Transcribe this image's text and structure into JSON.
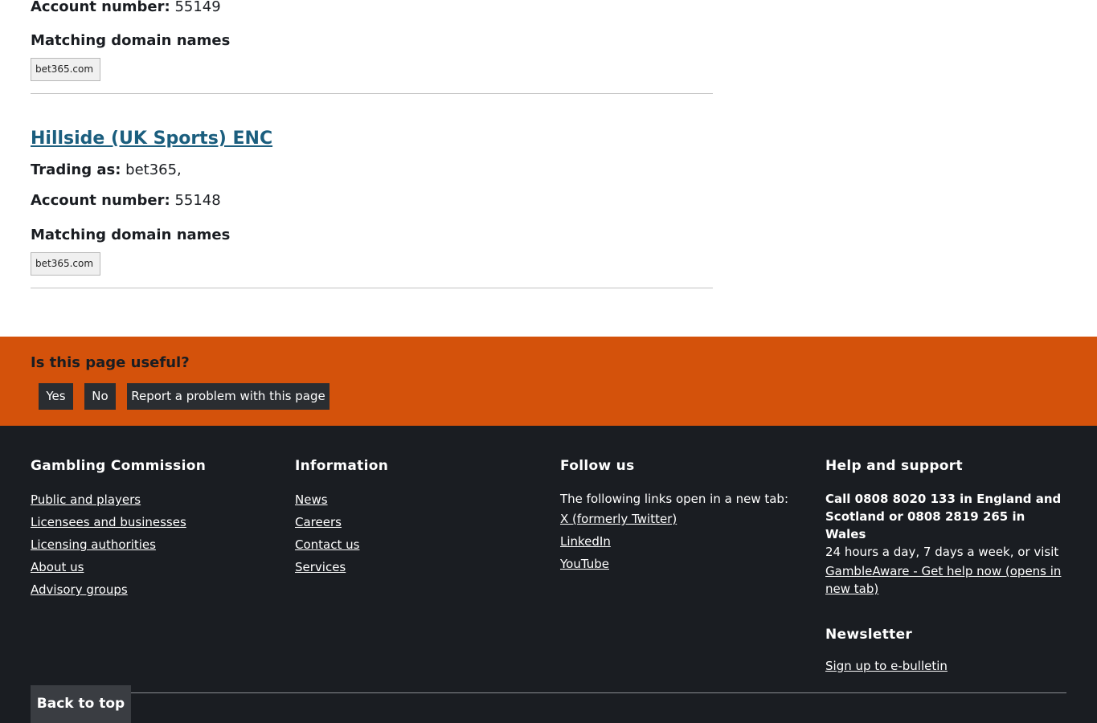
{
  "entries": [
    {
      "account_label": "Account number:",
      "account_number": "55149",
      "domains_heading": "Matching domain names",
      "domains": [
        "bet365.com"
      ]
    },
    {
      "title": "Hillside (UK Sports) ENC",
      "trading_label": "Trading as:",
      "trading_value": "bet365,",
      "account_label": "Account number:",
      "account_number": "55148",
      "domains_heading": "Matching domain names",
      "domains": [
        "bet365.com"
      ]
    }
  ],
  "feedback": {
    "question": "Is this page useful?",
    "yes": "Yes",
    "no": "No",
    "report": "Report a problem with this page",
    "background": "#d4520b"
  },
  "footer": {
    "background": "#1a1d22",
    "gambling_commission": {
      "heading": "Gambling Commission",
      "links": [
        "Public and players",
        "Licensees and businesses",
        "Licensing authorities",
        "About us",
        "Advisory groups"
      ]
    },
    "information": {
      "heading": "Information",
      "links": [
        "News",
        "Careers",
        "Contact us",
        "Services"
      ]
    },
    "follow_us": {
      "heading": "Follow us",
      "intro": "The following links open in a new tab:",
      "links": [
        "X (formerly Twitter)",
        "LinkedIn",
        "YouTube"
      ]
    },
    "help": {
      "heading": "Help and support",
      "call_text": "Call 0808 8020 133 in England and Scotland or 0808 2819 265 in Wales",
      "hours_text": "24 hours a day, 7 days a week, or visit",
      "link": "GambleAware - Get help now (opens in new tab)"
    },
    "newsletter": {
      "heading": "Newsletter",
      "link": "Sign up to e-bulletin"
    },
    "back_to_top": "Back to top"
  }
}
